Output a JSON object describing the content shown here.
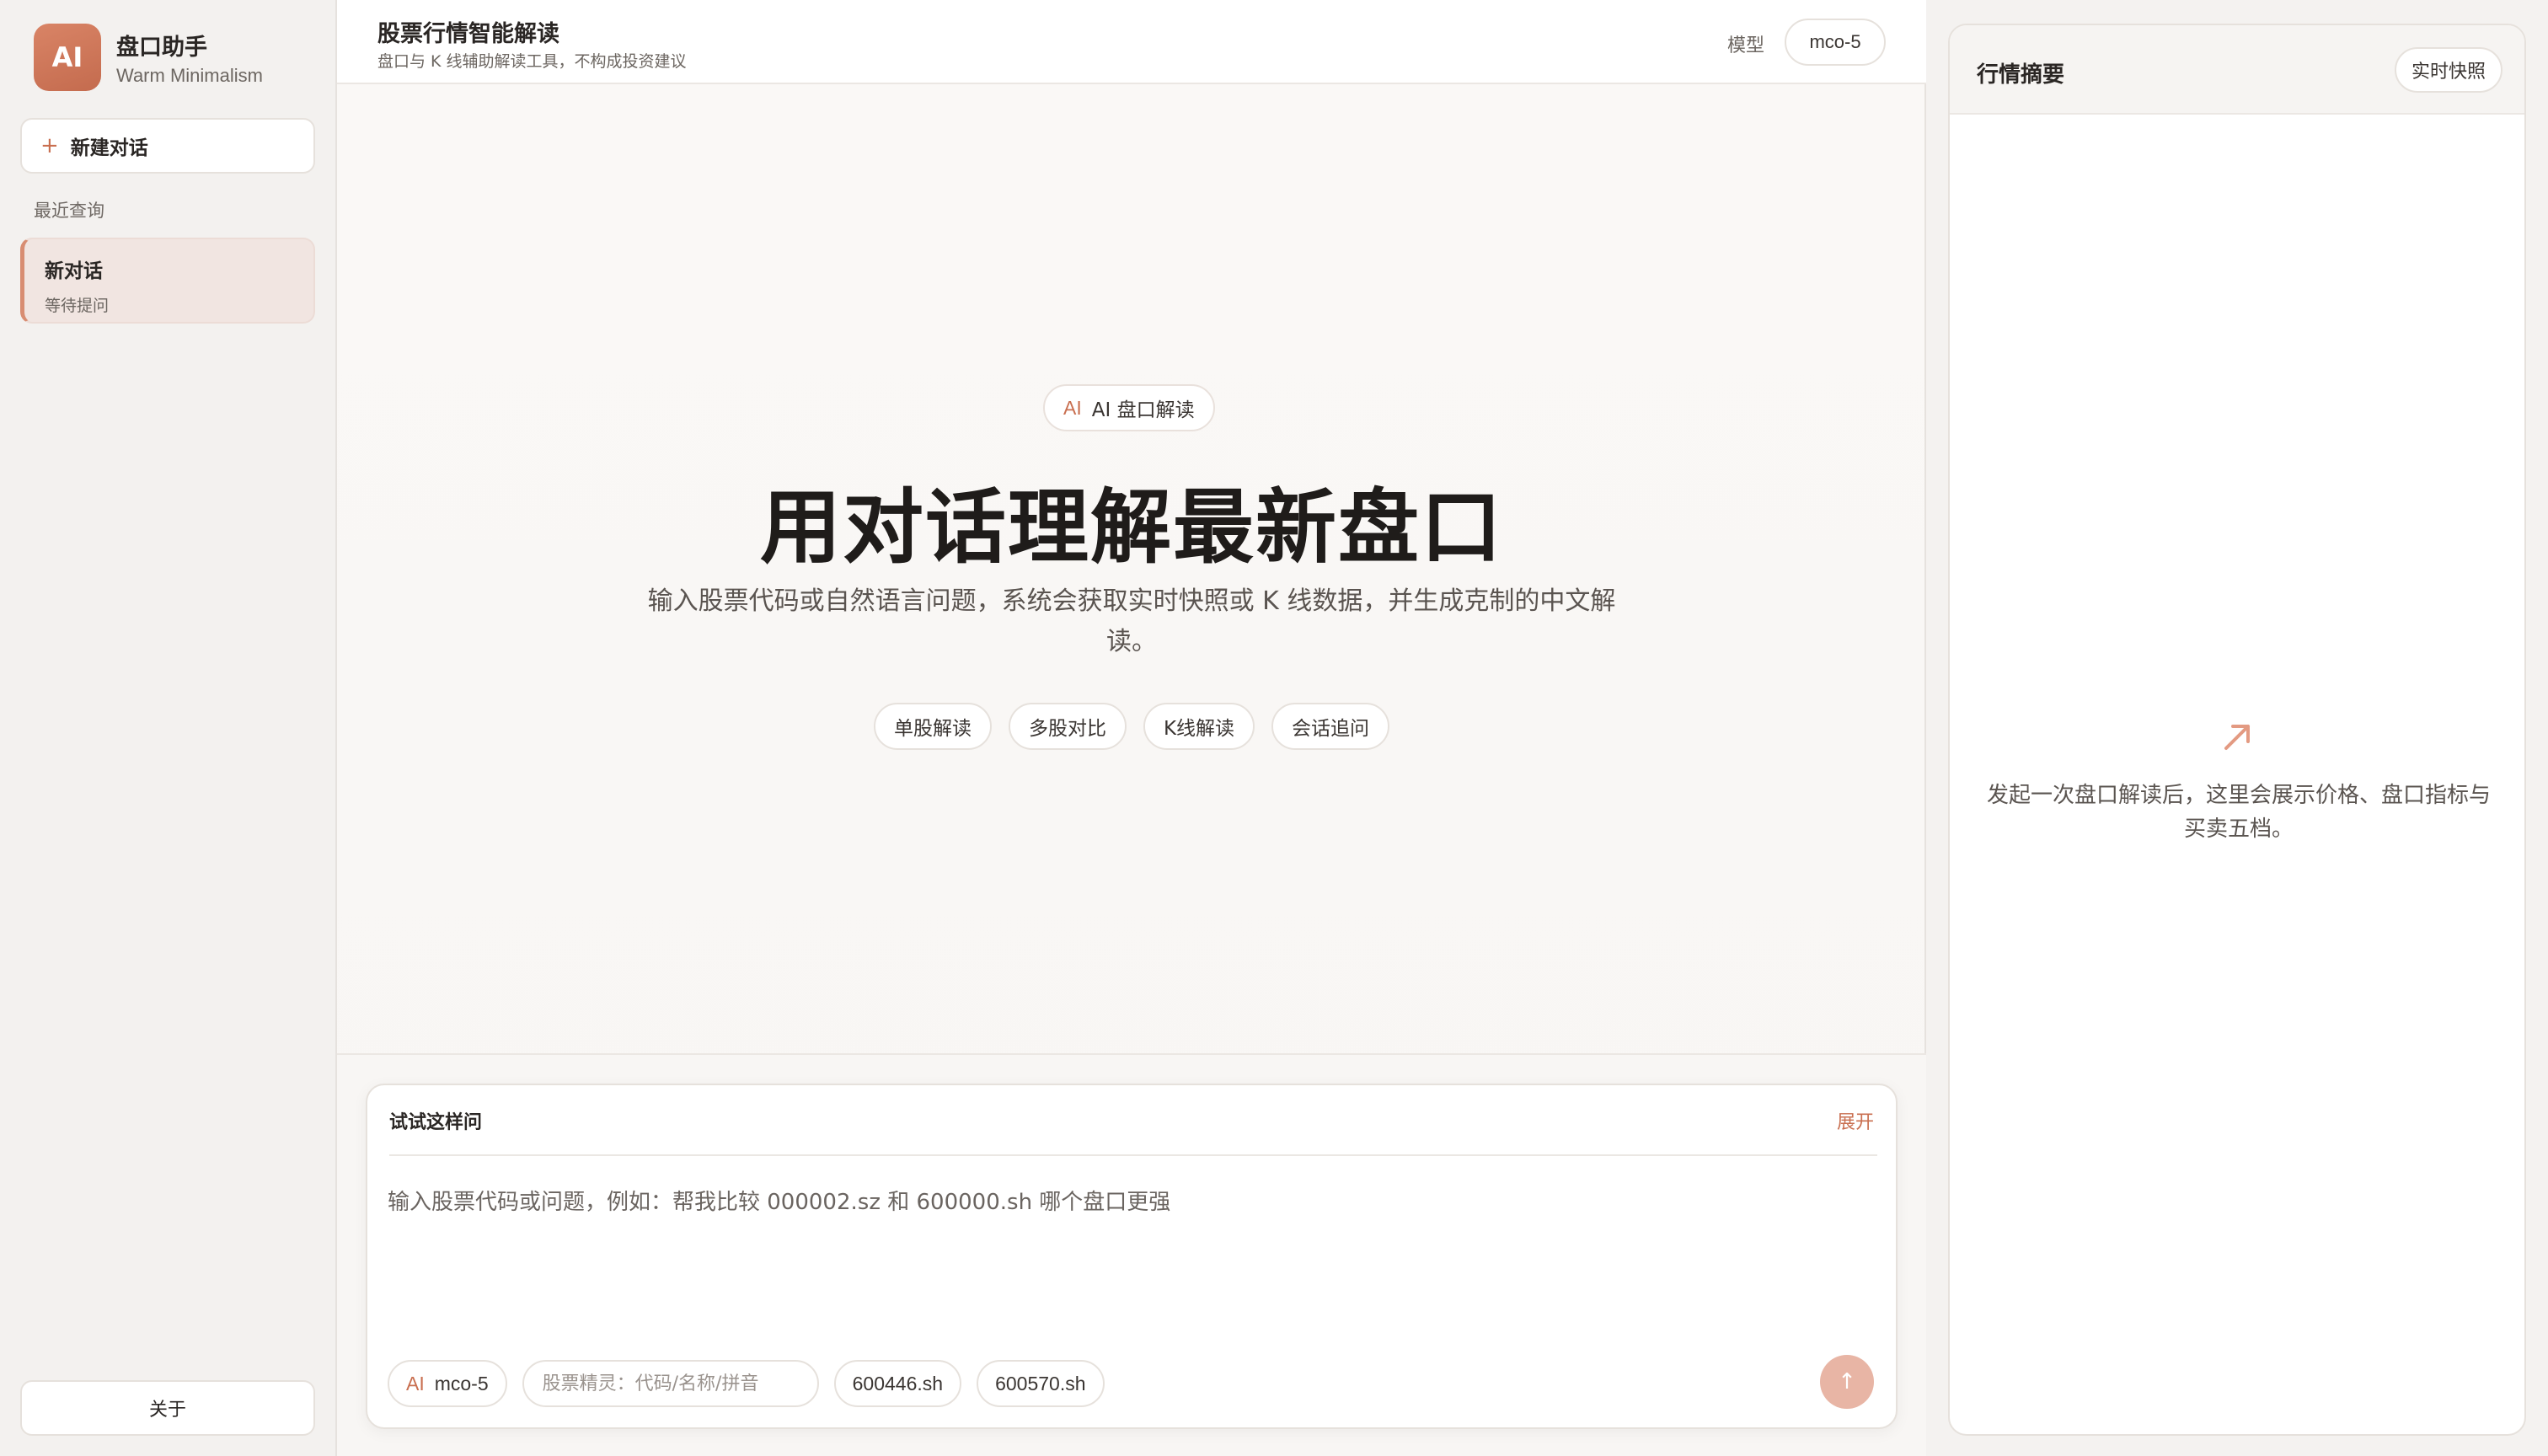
{
  "sidebar": {
    "logo_text": "AI",
    "app_name": "盘口助手",
    "app_tagline": "Warm Minimalism",
    "new_chat_label": "新建对话",
    "recent_label": "最近查询",
    "recent_items": [
      {
        "title": "新对话",
        "status": "等待提问"
      }
    ],
    "about_label": "关于"
  },
  "header": {
    "title": "股票行情智能解读",
    "subtitle": "盘口与 K 线辅助解读工具，不构成投资建议",
    "model_label": "模型",
    "model_value": "mco-5"
  },
  "hero": {
    "badge_mark": "AI",
    "badge_label": "AI 盘口解读",
    "title": "用对话理解最新盘口",
    "description": "输入股票代码或自然语言问题，系统会获取实时快照或 K 线数据，并生成克制的中文解读。",
    "chips": [
      "单股解读",
      "多股对比",
      "K线解读",
      "会话追问"
    ]
  },
  "composer": {
    "suggest_title": "试试这样问",
    "expand_label": "展开",
    "placeholder": "输入股票代码或问题，例如：帮我比较 000002.sz 和 600000.sh 哪个盘口更强",
    "model_mark": "AI",
    "model_chip": "mco-5",
    "stock_search_placeholder": "股票精灵：代码/名称/拼音",
    "quick_stocks": [
      "600446.sh",
      "600570.sh"
    ],
    "send_icon": "↑"
  },
  "right_panel": {
    "title": "行情摘要",
    "snapshot_label": "实时快照",
    "empty_text": "发起一次盘口解读后，这里会展示价格、盘口指标与买卖五档。"
  },
  "colors": {
    "accent": "#c96f50",
    "send_button": "#e8b5a5",
    "recent_highlight": "#f1e5e1"
  }
}
